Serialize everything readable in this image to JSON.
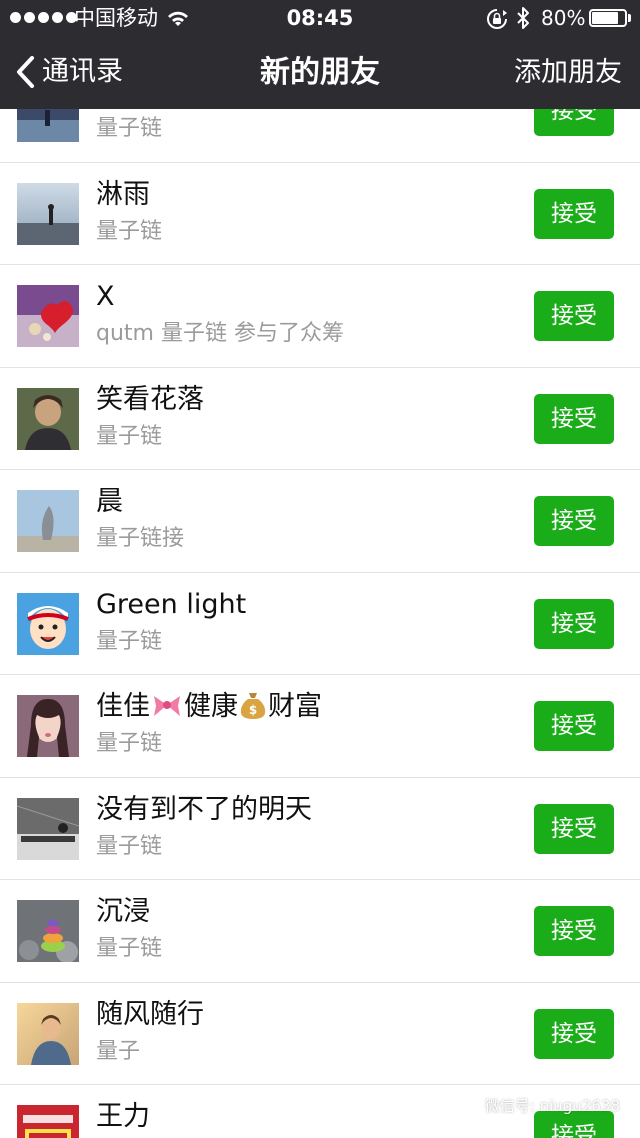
{
  "status_bar": {
    "carrier": "中国移动",
    "time": "08:45",
    "battery_percent_label": "80%",
    "battery_level": 0.8,
    "icons": [
      "signal-dots-icon",
      "wifi-icon",
      "rotation-lock-icon",
      "bluetooth-icon",
      "battery-icon"
    ]
  },
  "nav": {
    "back_label": "通讯录",
    "title": "新的朋友",
    "action_label": "添加朋友"
  },
  "contacts": [
    {
      "name": "",
      "message": "量子链",
      "button": "接受"
    },
    {
      "name": "淋雨",
      "message": "量子链",
      "button": "接受"
    },
    {
      "name": "X",
      "message": "qutm 量子链 参与了众筹",
      "button": "接受"
    },
    {
      "name": "笑看花落",
      "message": "量子链",
      "button": "接受"
    },
    {
      "name": "晨",
      "message": "量子链接",
      "button": "接受"
    },
    {
      "name": "Green light",
      "message": "量子链",
      "button": "接受"
    },
    {
      "name_part1": "佳佳",
      "name_part2": "健康",
      "name_part3": "财富",
      "message": "量子链",
      "button": "接受"
    },
    {
      "name": "没有到不了的明天",
      "message": "量子链",
      "button": "接受"
    },
    {
      "name": "沉浸",
      "message": "量子链",
      "button": "接受"
    },
    {
      "name": "随风随行",
      "message": "量子",
      "button": "接受"
    },
    {
      "name": "王力",
      "message": "",
      "button": "接受"
    }
  ],
  "watermark": {
    "text": "微信号: niugu2638"
  },
  "colors": {
    "nav_background": "#2d2c31",
    "accept_green": "#1aad19",
    "secondary_text": "#9b9b9b",
    "divider": "#e3e3e5"
  }
}
